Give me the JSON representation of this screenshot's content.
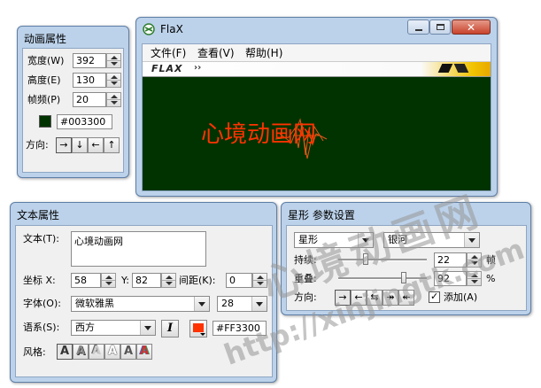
{
  "anim_panel": {
    "title": "动画属性",
    "width_label": "宽度(W)",
    "width_value": "392",
    "height_label": "高度(E)",
    "height_value": "130",
    "fps_label": "帧频(P)",
    "fps_value": "20",
    "bg_color": "#003300",
    "bg_color_text": "#003300",
    "direction_label": "方向:",
    "direction_buttons": [
      "→",
      "↓",
      "←",
      "↑"
    ]
  },
  "flax_window": {
    "title": "FlaX",
    "menu": [
      "文件(F)",
      "查看(V)",
      "帮助(H)"
    ],
    "logo_text": "FLAX",
    "canvas_bg": "#003300",
    "canvas_text": "心境动画网",
    "canvas_text_color": "#FF3300"
  },
  "text_panel": {
    "title": "文本属性",
    "text_label": "文本(T):",
    "text_value": "心境动画网",
    "coord_label": "坐标 X:",
    "x_value": "58",
    "y_label": "Y:",
    "y_value": "82",
    "spacing_label": "间距(K):",
    "spacing_value": "0",
    "font_label": "字体(O):",
    "font_value": "微软雅黑",
    "size_value": "28",
    "lang_label": "语系(S):",
    "lang_value": "西方",
    "italic_label": "I",
    "color": "#FF3300",
    "color_text": "#FF3300",
    "style_label": "风格:",
    "style_buttons": [
      "A",
      "A",
      "A",
      "A",
      "A",
      "A"
    ]
  },
  "star_panel": {
    "title": "星形 参数设置",
    "shape_value": "星形",
    "preset_value": "银河",
    "duration_label": "持续:",
    "duration_value": "22",
    "duration_unit": "帧",
    "overlap_label": "重叠:",
    "overlap_value": "92",
    "overlap_unit": "%",
    "duration_fraction": 0.3,
    "overlap_fraction": 0.75,
    "direction_label": "方向:",
    "direction_buttons": [
      "→",
      "←",
      "⇆",
      "↠",
      "↞"
    ],
    "add_label": "添加(A)",
    "add_checked": true
  },
  "watermark": {
    "line1": "心境动画网",
    "line2": "http://xinjingtk.com"
  }
}
